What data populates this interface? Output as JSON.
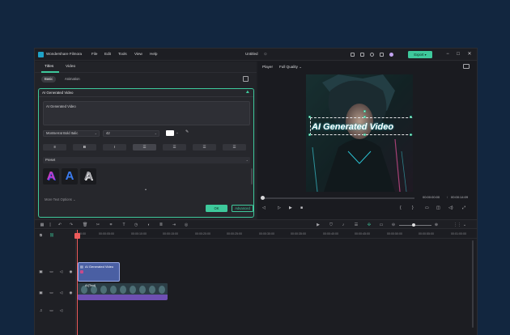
{
  "app": {
    "name": "Wondershare Filmora",
    "menu": [
      "File",
      "Edit",
      "Tools",
      "View",
      "Help"
    ],
    "document_title": "Untitled",
    "export_label": "Export"
  },
  "left_panel": {
    "tabs": [
      "Titles",
      "Video"
    ],
    "subtabs": [
      "Basic",
      "Animation"
    ],
    "card_title": "AI Generated Video",
    "text_value": "AI Generated Video",
    "font": "Montserrat Bold Italic",
    "font_size": "42",
    "text_color": "#ffffff",
    "format_buttons": [
      "align-left-justified-icon",
      "bold-icon",
      "italic-icon",
      "align-left-icon",
      "align-center-icon",
      "align-right-icon",
      "align-justify-icon"
    ],
    "preset_label": "Preset",
    "presets": [
      {
        "letter": "A",
        "color": "#c63ec8"
      },
      {
        "letter": "A",
        "color": "#3b7cf2"
      },
      {
        "letter": "A",
        "color": "#9a9aa0"
      }
    ],
    "more_options": "More Text Options",
    "ok_label": "OK",
    "advanced_label": "Advanced"
  },
  "player": {
    "label": "Player",
    "quality": "Full Quality",
    "overlay_text": "AI Generated Video",
    "current_time": "00:00:00:00",
    "total_time": "00:00:14:09"
  },
  "timeline": {
    "ticks": [
      "00:00",
      "00:00:05:00",
      "00:00:10:00",
      "00:00:15:00",
      "00:00:20:00",
      "00:00:25:00",
      "00:00:30:00",
      "00:00:35:00",
      "00:00:40:00",
      "00:00:45:00",
      "00:00:50:00",
      "00:00:55:00",
      "00:01:00:00"
    ],
    "title_clip": "AI Generated Video",
    "video_clip": "AI(Text)"
  },
  "colors": {
    "accent": "#3ec99c",
    "playhead": "#ee5b5b",
    "title_clip": "#4a5fa3",
    "audio_clip": "#6e4fb2"
  }
}
